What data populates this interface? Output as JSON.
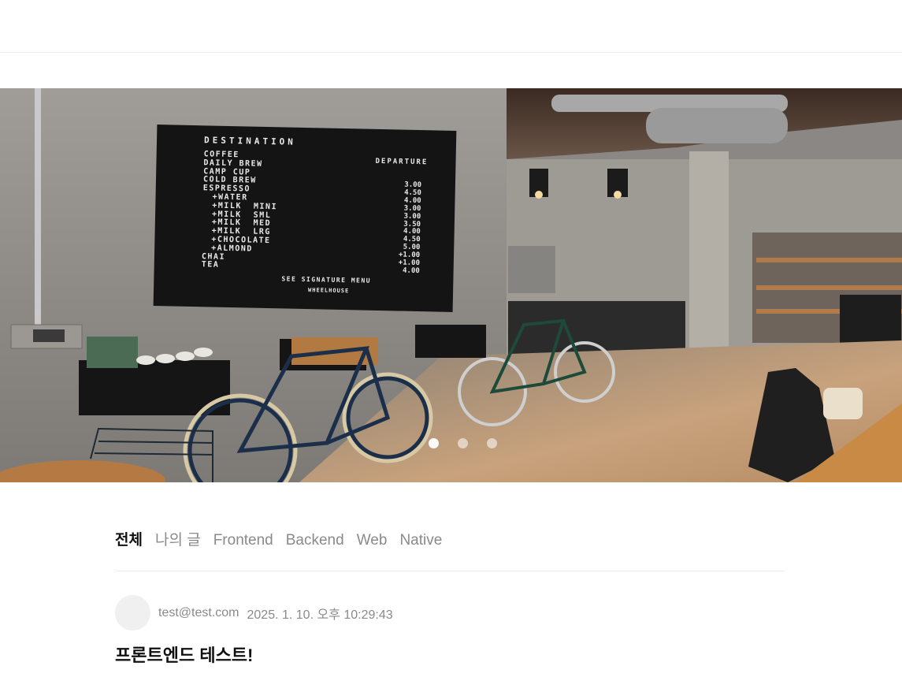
{
  "tabs": [
    {
      "label": "전체",
      "active": true
    },
    {
      "label": "나의 글",
      "active": false
    },
    {
      "label": "Frontend",
      "active": false
    },
    {
      "label": "Backend",
      "active": false
    },
    {
      "label": "Web",
      "active": false
    },
    {
      "label": "Native",
      "active": false
    }
  ],
  "hero": {
    "board": {
      "header_left": "DESTINATION",
      "header_right": "DEPARTURE",
      "items": [
        "COFFEE",
        "DAILY BREW",
        "CAMP CUP",
        "COLD BREW",
        "ESPRESSO",
        "+WATER",
        "+MILK  MINI",
        "+MILK  SML",
        "+MILK  MED",
        "+MILK  LRG",
        "+CHOCOLATE",
        "+ALMOND",
        "CHAI",
        "TEA"
      ],
      "prices": [
        "3.00",
        "4.50",
        "4.00",
        "3.00",
        "3.00",
        "3.50",
        "4.00",
        "4.50",
        "5.00",
        "+1.00",
        "+1.00",
        "4.00"
      ],
      "footer": "SEE SIGNATURE MENU",
      "brand": "WHEELHOUSE"
    },
    "carousel": {
      "count": 3,
      "active_index": 0
    }
  },
  "post": {
    "author": "test@test.com",
    "date": "2025. 1. 10. 오후 10:29:43",
    "title": "프론트엔드 테스트!"
  }
}
